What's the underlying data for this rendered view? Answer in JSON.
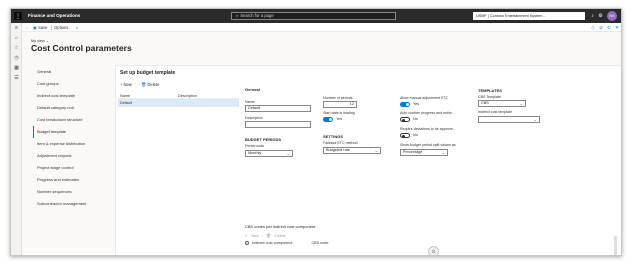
{
  "app": {
    "title": "Finance and Operations",
    "search_placeholder": "Search for a page",
    "company": "USMF | Contoso Entertainment System...",
    "avatar_initials": "NS"
  },
  "actions": {
    "save": "Save",
    "options": "Options"
  },
  "header": {
    "breadcrumb": "My view",
    "title": "Cost Control parameters"
  },
  "nav": {
    "items": [
      {
        "label": "General"
      },
      {
        "label": "Cost groups"
      },
      {
        "label": "Indirect cost template"
      },
      {
        "label": "Default category unit"
      },
      {
        "label": "Cost breakdown structure"
      },
      {
        "label": "Budget template"
      },
      {
        "label": "Item & expense distribution"
      },
      {
        "label": "Adjustment request"
      },
      {
        "label": "Project stage control"
      },
      {
        "label": "Progress and estimates"
      },
      {
        "label": "Number sequences"
      },
      {
        "label": "Subcontractor management"
      }
    ],
    "active_index": 5
  },
  "budget_template": {
    "title": "Set up budget template",
    "new_label": "New",
    "delete_label": "Delete",
    "columns": [
      "Name",
      "Description"
    ],
    "rows": [
      {
        "name": "Default",
        "description": ""
      }
    ]
  },
  "form": {
    "general": {
      "heading": "General",
      "name_label": "Name",
      "name_value": "Default",
      "description_label": "Description",
      "description_value": ""
    },
    "budget_periods": {
      "heading": "BUDGET PERIODS",
      "period_code_label": "Period code",
      "period_code_value": "Monthly"
    },
    "periods": {
      "number_label": "Number of periods",
      "number_value": "12",
      "start_date_label": "Start date is leading",
      "start_date_toggle": "Yes"
    },
    "settings": {
      "heading": "SETTINGS",
      "etc_method_label": "Fallback ETC method",
      "etc_method_value": "Budgeted rate"
    },
    "etc": {
      "allow_manual_label": "Allow manual adjustment ETC",
      "allow_manual_toggle": "Yes",
      "auto_confirm_label": "Auto confirm progress and estim...",
      "auto_confirm_toggle": "No",
      "require_deviations_label": "Require deviations to be approve...",
      "require_deviations_toggle": "No",
      "show_split_label": "Show budget period split values as",
      "show_split_value": "Percentage"
    },
    "templates": {
      "heading": "TEMPLATES",
      "cbs_label": "CBS Template",
      "cbs_value": "CBS",
      "indirect_label": "Indirect cost template",
      "indirect_value": ""
    }
  },
  "cbs_codes": {
    "title": "CBS codes per indirect cost component",
    "new_label": "New",
    "delete_label": "Delete",
    "col_component": "Indirect cost component",
    "col_code": "CBS code"
  }
}
